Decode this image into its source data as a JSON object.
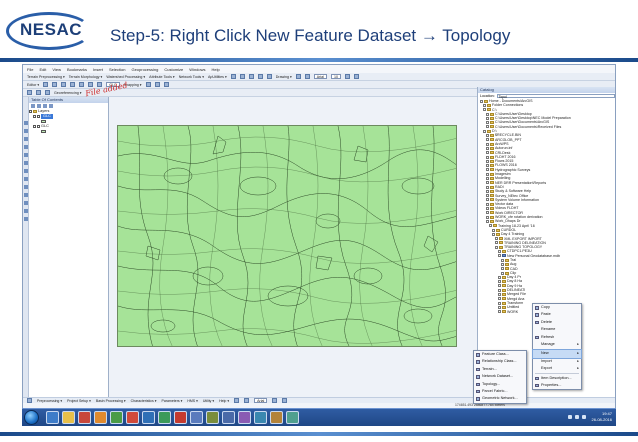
{
  "slide": {
    "logo_text": "NESAC",
    "title": "Step-5:  Right Click New Feature Dataset → Topology",
    "annotation": "File added"
  },
  "app": {
    "menu": [
      "File",
      "Edit",
      "View",
      "Bookmarks",
      "Insert",
      "Selection",
      "Geoprocessing",
      "Customize",
      "Windows",
      "Help"
    ],
    "toolbar1": [
      "Terrain Preprocessing ▾",
      "Terrain Morphology ▾",
      "Watershed Processing ▾",
      "Attribute Tools ▾",
      "Network Tools ▾",
      "ApUtilities ▾"
    ],
    "toolbar1_right": [
      "Drawing ▾",
      "Arial",
      "10"
    ],
    "toolbar2_label": "Editor ▾",
    "layer_select": "GLC",
    "snapping": "Snapping ▾",
    "georef_label": "Georeferencing ▾"
  },
  "toc": {
    "title": "Table Of Contents",
    "layers_label": "Layers",
    "layer1": "GLC",
    "layer2": "GLC"
  },
  "catalog": {
    "title": "Catalog",
    "location_label": "Location:",
    "location_value": "Topol",
    "items": [
      "Home - Documents\\ArcGIS",
      "Folder Connections",
      "C:\\",
      "C:\\Users\\User\\Desktop",
      "C:\\Users\\User\\Desktop\\NEC Model Preparation",
      "C:\\Users\\User\\Documents\\ArcGIS",
      "C:\\Users\\User\\Documents\\Received Files",
      "D:\\",
      "$RECYCLE.BIN",
      "ARCGLOB_PPT",
      "ArcWPS",
      "Autorun.inf",
      "CRLDesk",
      "FLDHT 2016",
      "Flows 2015",
      "FLOWS 2016",
      "Hydrographic Surveys",
      "Imagesim",
      "Modelling",
      "NER DRR Presentation\\Reports",
      "RADI",
      "Study & Software Help",
      "Survey_NEtec Office",
      "System Volume Information",
      "Vector data",
      "Videos FLDHT",
      "Work DIRECTOR",
      "WORK_cfe rotation derivation",
      "Work_Dhaps Dr",
      "Training 18-23 April '16",
      "CURDOL",
      "Day 4 Training",
      "XML EXPORT IMPORT",
      "TRAINING DELINEATION",
      "TRAINING TOPOLOGY",
      "CTDPC1.PE3U",
      "New Personal Geodatabase.mdb",
      "Trai",
      "Aug",
      "CAD",
      "Clip",
      "Day 4 Pr",
      "Day 8 Ha",
      "Day 9 Ha",
      "DELINEATI",
      "Merged File",
      "Mergd Ana",
      "Transform",
      "Untitled",
      "WORK"
    ]
  },
  "context_menu": {
    "items": [
      "Copy",
      "Paste",
      "Delete",
      "Rename",
      "Refresh",
      "Manage",
      "New",
      "Import",
      "Export",
      "Item Description...",
      "Properties..."
    ]
  },
  "new_submenu": {
    "items": [
      "Feature Class...",
      "Relationship Class...",
      "Terrain...",
      "Network Dataset...",
      "Topology...",
      "Parcel Fabric...",
      "Geometric Network..."
    ]
  },
  "drawbar": {
    "items": [
      "Preprocessing ▾",
      "Project Setup ▾",
      "Basin Processing ▾",
      "Characteristics ▾",
      "Parameters ▾",
      "HMS ▾",
      "Utility ▾",
      "Help ▾"
    ],
    "font": "Arial"
  },
  "status": {
    "coords": "174651.493  2586877.784 Meters"
  },
  "taskbar": {
    "time": "19:47",
    "date": "26-08-2016",
    "lang": "ENG"
  }
}
